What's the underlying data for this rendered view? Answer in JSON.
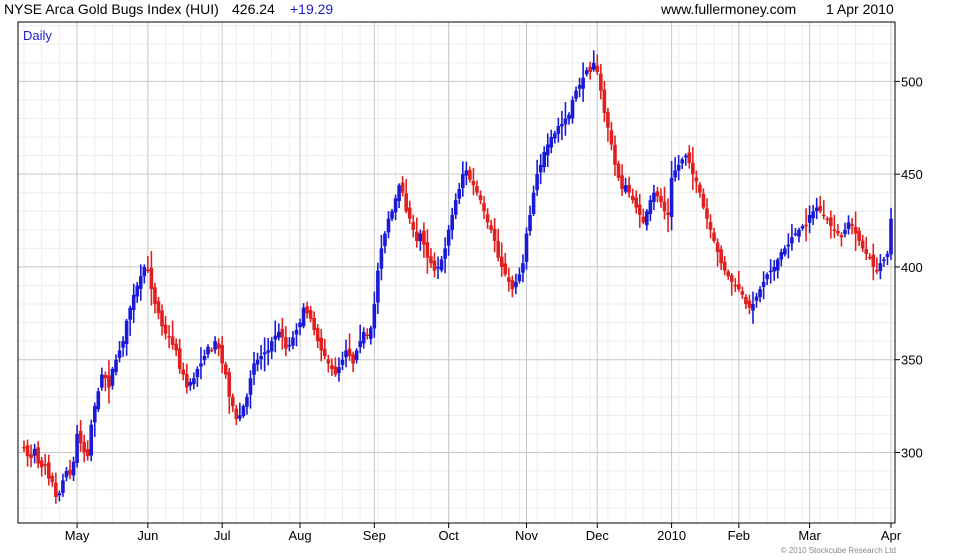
{
  "header": {
    "title": "NYSE Arca Gold Bugs Index (HUI)",
    "last": "426.24",
    "change": "+19.29",
    "website": "www.fullermoney.com",
    "date": "1 Apr 2010"
  },
  "footer": {
    "credit": "© 2010 Stockcube Research Ltd"
  },
  "colors": {
    "up": "#1a1ad6",
    "down": "#e02020",
    "grid_major": "#c8c8c8",
    "grid_minor": "#ececec",
    "axis": "#000000"
  },
  "chart_data": {
    "type": "ohlc",
    "title": "NYSE Arca Gold Bugs Index (HUI)",
    "period_label": "Daily",
    "xlabel": "",
    "ylabel": "",
    "ylim": [
      262,
      532
    ],
    "y_ticks": [
      300,
      350,
      400,
      450,
      500
    ],
    "x_ticks": [
      "May",
      "Jun",
      "Jul",
      "Aug",
      "Sep",
      "Oct",
      "Nov",
      "Dec",
      "2010",
      "Feb",
      "Mar",
      "Apr"
    ],
    "grid": true,
    "legend": "none",
    "y_axis_position": "right",
    "series": [
      {
        "close_by_month": [
          {
            "month": "Apr 2009",
            "close": [
              303,
              298,
              297,
              302,
              294,
              292,
              293,
              286,
              284,
              276,
              278,
              285,
              290,
              288,
              295
            ]
          },
          {
            "month": "May 2009",
            "close": [
              310,
              305,
              300,
              298,
              315,
              325,
              333,
              342,
              340,
              335,
              345,
              350,
              355,
              360,
              371,
              378,
              385,
              390,
              395,
              400
            ]
          },
          {
            "month": "Jun 2009",
            "close": [
              398,
              388,
              380,
              375,
              368,
              364,
              362,
              358,
              355,
              345,
              342,
              335,
              338,
              340,
              345,
              348,
              352,
              357,
              355,
              360,
              356
            ]
          },
          {
            "month": "Jul 2009",
            "close": [
              348,
              342,
              330,
              325,
              318,
              320,
              325,
              330,
              340,
              348,
              350,
              352,
              354,
              355,
              360,
              363,
              365,
              362,
              356,
              358,
              362,
              366
            ]
          },
          {
            "month": "Aug 2009",
            "close": [
              370,
              378,
              375,
              372,
              366,
              360,
              355,
              352,
              348,
              345,
              342,
              346,
              350,
              355,
              352,
              348,
              355,
              360,
              365,
              363,
              367
            ]
          },
          {
            "month": "Sep 2009",
            "close": [
              380,
              398,
              410,
              418,
              426,
              430,
              437,
              444,
              440,
              430,
              426,
              420,
              414,
              418,
              412,
              405,
              402,
              398,
              400,
              404,
              410
            ]
          },
          {
            "month": "Oct 2009",
            "close": [
              420,
              428,
              436,
              442,
              450,
              452,
              447,
              444,
              440,
              436,
              430,
              424,
              420,
              414,
              405,
              400,
              396,
              392,
              388,
              392,
              396,
              402
            ]
          },
          {
            "month": "Nov 2009",
            "close": [
              418,
              428,
              440,
              450,
              455,
              462,
              466,
              470,
              472,
              476,
              477,
              480,
              482,
              490,
              495,
              498,
              502,
              506,
              505,
              510
            ]
          },
          {
            "month": "Dec 2009",
            "close": [
              505,
              495,
              483,
              475,
              466,
              455,
              448,
              442,
              444,
              440,
              436,
              432,
              428,
              424,
              430,
              436,
              440,
              438,
              435,
              430,
              428
            ]
          },
          {
            "month": "Jan 2010",
            "close": [
              448,
              452,
              455,
              458,
              460,
              456,
              450,
              446,
              440,
              432,
              426,
              420,
              414,
              408,
              402,
              398,
              395,
              392,
              390
            ]
          },
          {
            "month": "Feb 2010",
            "close": [
              388,
              385,
              380,
              378,
              380,
              384,
              388,
              392,
              396,
              398,
              400,
              404,
              408,
              410,
              412,
              416,
              418,
              420,
              422,
              422
            ]
          },
          {
            "month": "Mar 2010",
            "close": [
              428,
              430,
              432,
              430,
              428,
              426,
              422,
              420,
              418,
              416,
              420,
              424,
              422,
              418,
              414,
              410,
              407,
              405,
              400,
              398,
              402,
              404,
              407
            ]
          },
          {
            "month": "Apr 2010",
            "close": [
              426
            ]
          }
        ]
      }
    ]
  }
}
